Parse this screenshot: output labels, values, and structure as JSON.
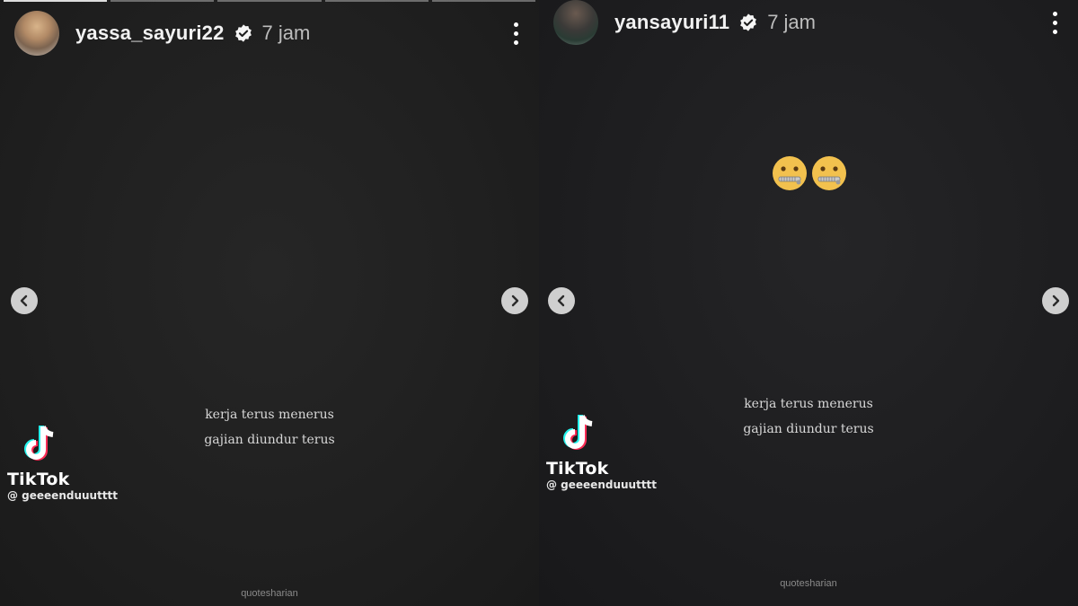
{
  "stories": [
    {
      "username": "yassa_sayuri22",
      "time": "7 jam",
      "quote_line1": "kerja terus menerus",
      "quote_line2": "gajian diundur terus",
      "tiktok_word": "TikTok",
      "tiktok_handle": "@ geeeenduuutttt",
      "source_text": "quotesharian"
    },
    {
      "username": "yansayuri11",
      "time": "7 jam",
      "emoji_name": "zipper-mouth-face-icon",
      "quote_line1": "kerja terus menerus",
      "quote_line2": "gajian diundur terus",
      "tiktok_word": "TikTok",
      "tiktok_handle": "@ geeeenduuutttt",
      "source_text": "quotesharian"
    }
  ],
  "icons": {
    "verified": "verified-badge-icon",
    "more": "more-vertical-icon",
    "prev": "chevron-left-icon",
    "next": "chevron-right-icon",
    "tiktok": "tiktok-logo-icon"
  },
  "colors": {
    "background": "#1c1c1c",
    "nav_button": "#cfcfcf",
    "emoji_yellow": "#f2c14e"
  }
}
